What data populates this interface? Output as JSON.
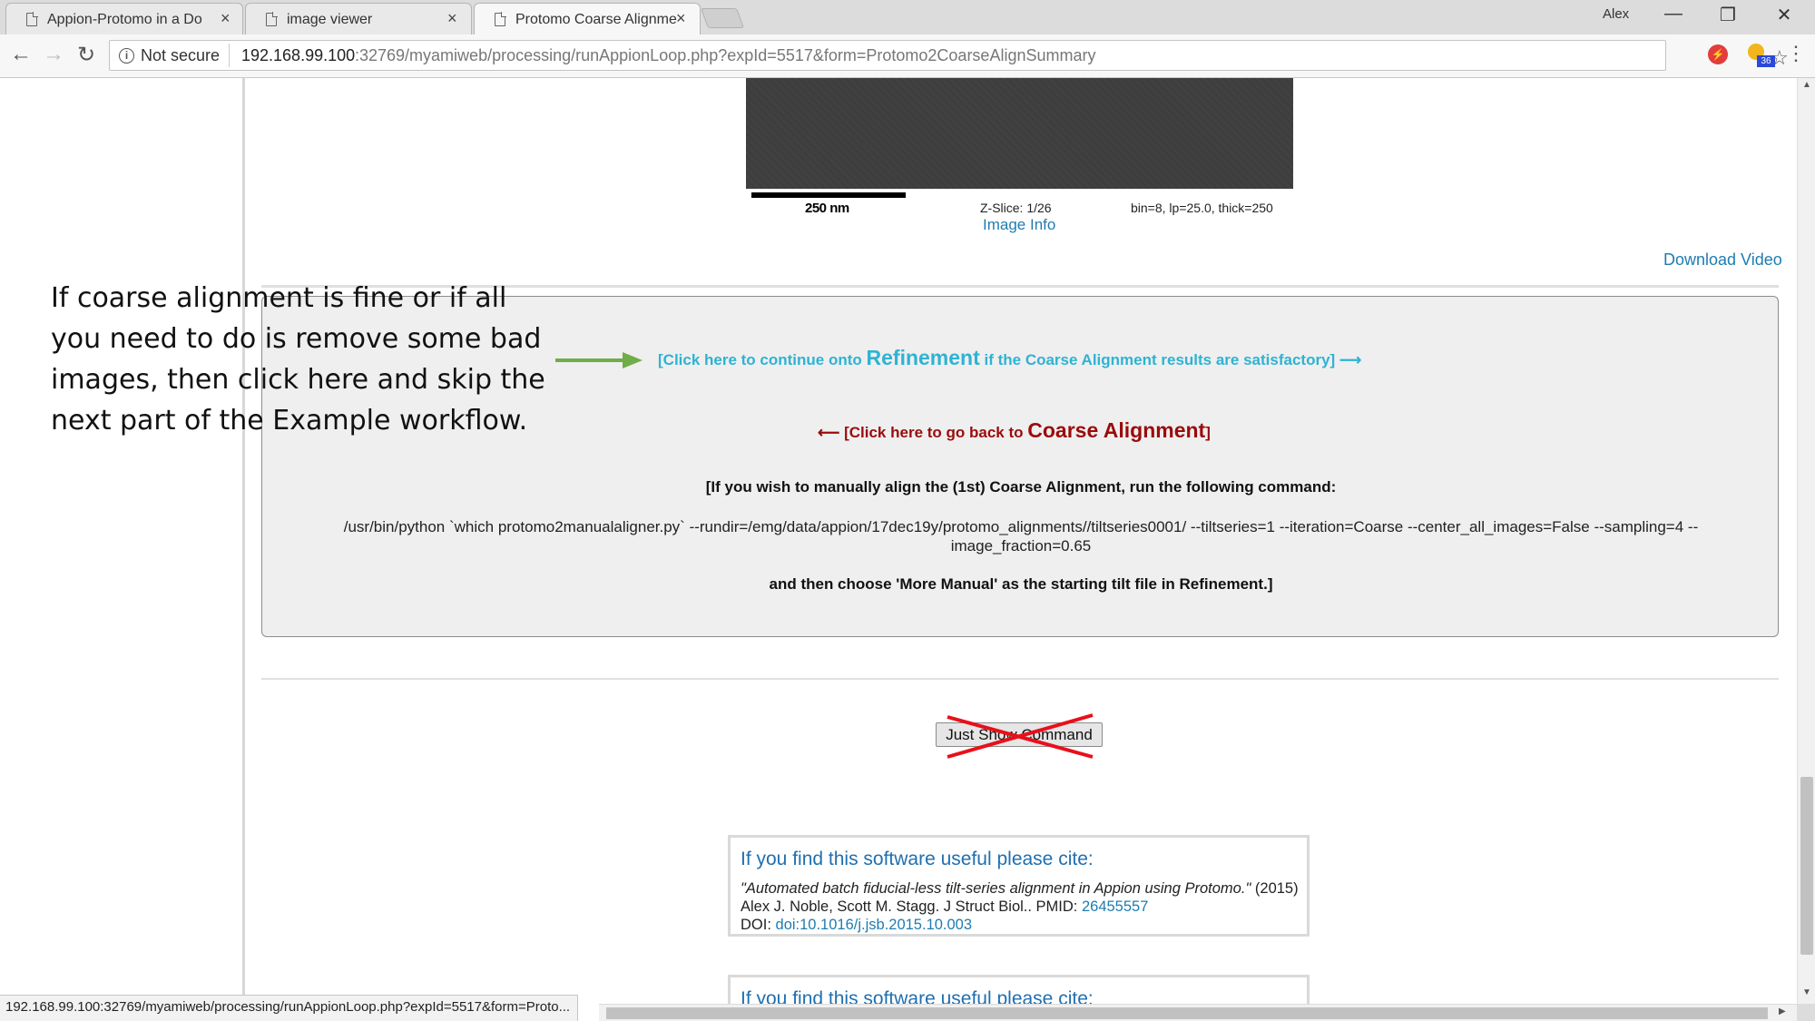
{
  "browser": {
    "tabs": [
      {
        "title": "Appion-Protomo in a Do",
        "active": false
      },
      {
        "title": "image viewer",
        "active": false
      },
      {
        "title": "Protomo Coarse Alignme",
        "active": true
      }
    ],
    "profile_name": "Alex",
    "security_label": "Not secure",
    "url_host": "192.168.99.100",
    "url_rest": ":32769/myamiweb/processing/runAppionLoop.php?expId=5517&form=Protomo2CoarseAlignSummary",
    "extension_badge": "36",
    "status_url": "192.168.99.100:32769/myamiweb/processing/runAppionLoop.php?expId=5517&form=Proto..."
  },
  "icons": {
    "back": "←",
    "forward": "→",
    "reload": "↻",
    "star": "☆",
    "menu": "⋮",
    "tab_close": "×",
    "minimize": "—",
    "restore": "❐",
    "close": "✕",
    "scroll_up": "▲",
    "scroll_down": "▼",
    "scroll_right": "▶",
    "info": "i"
  },
  "movie": {
    "scale_label": "250 nm",
    "zslice": "Z-Slice: 1/26",
    "params": "bin=8, lp=25.0, thick=250",
    "image_info_link": "Image Info"
  },
  "download_video": "Download Video",
  "refinement_link": {
    "prefix": "[Click here to continue onto ",
    "strong": "Refinement",
    "suffix": " if the Coarse Alignment results are satisfactory] ⟶",
    "color": "#2eb3d3"
  },
  "back_link": {
    "prefix": "⟵ [Click here to go back to ",
    "strong": "Coarse Alignment",
    "suffix": "]",
    "color": "#9b0b0b"
  },
  "manual": {
    "heading": "[If you wish to manually align the (1st) Coarse Alignment, run the following command:",
    "command": "/usr/bin/python `which protomo2manualaligner.py` --rundir=/emg/data/appion/17dec19y/protomo_alignments//tiltseries0001/ --tiltseries=1 --iteration=Coarse --center_all_images=False --sampling=4 --image_fraction=0.65",
    "footer": "and then choose 'More Manual' as the starting tilt file in Refinement.]"
  },
  "just_show_command_label": "Just Show Command",
  "citation": {
    "heading": "If you find this software useful please cite:",
    "title": "\"Automated batch fiducial-less tilt-series alignment in Appion using Protomo.\"",
    "authors": " (2015) Alex J. Noble, Scott M. Stagg. J Struct Biol..  PMID: ",
    "pmid": "26455557",
    "doi_label": "DOI: ",
    "doi": "doi:10.1016/j.jsb.2015.10.003"
  },
  "citation2_heading": "If you find this software useful please cite:",
  "annotation": {
    "lines": [
      "If coarse alignment is fine or if all",
      "you need to do is remove some bad",
      "images, then click here and skip the",
      "next part of the Example workflow."
    ],
    "arrow_color": "#70ad47",
    "cross_color": "#e8101a"
  }
}
